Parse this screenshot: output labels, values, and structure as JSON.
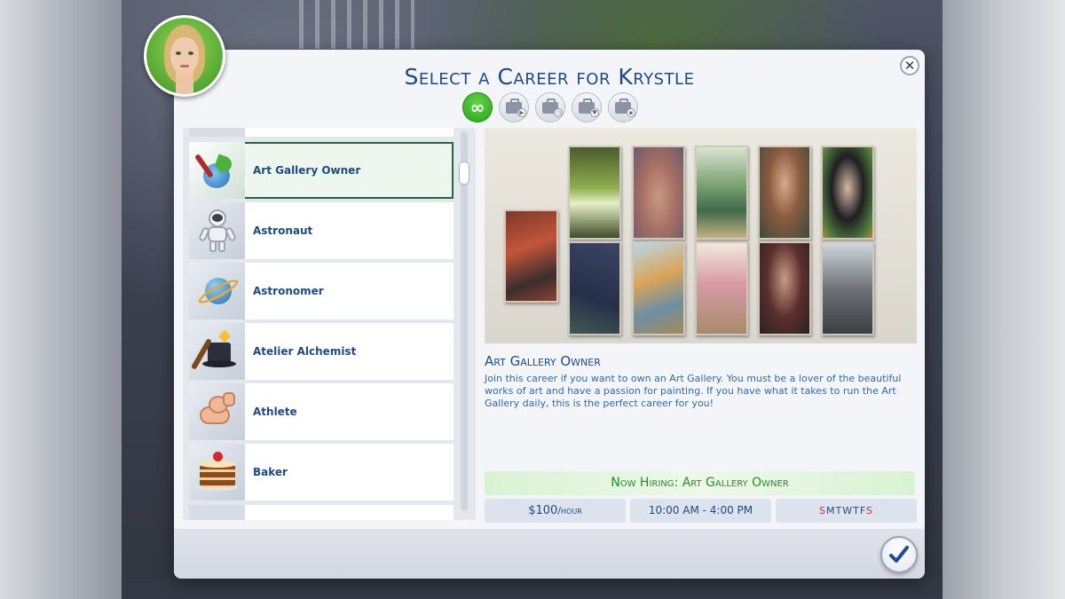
{
  "dialog": {
    "title": "Select a Career for Krystle",
    "close_label": "✕"
  },
  "filters": [
    {
      "name": "all",
      "icon": "infinity-icon",
      "active": true
    },
    {
      "name": "active-careers",
      "icon": "briefcase-play-icon",
      "active": false
    },
    {
      "name": "part-time",
      "icon": "briefcase-clock-icon",
      "active": false
    },
    {
      "name": "volunteer",
      "icon": "briefcase-heart-icon",
      "active": false
    },
    {
      "name": "freelance",
      "icon": "briefcases-icon",
      "active": false
    }
  ],
  "careers": [
    {
      "label": "Art Gallery Owner",
      "icon": "paintbrush-globe-icon",
      "selected": true
    },
    {
      "label": "Astronaut",
      "icon": "astronaut-icon",
      "selected": false
    },
    {
      "label": "Astronomer",
      "icon": "planet-icon",
      "selected": false
    },
    {
      "label": "Atelier Alchemist",
      "icon": "magic-hat-icon",
      "selected": false
    },
    {
      "label": "Athlete",
      "icon": "flexed-arm-icon",
      "selected": false
    },
    {
      "label": "Baker",
      "icon": "cake-icon",
      "selected": false
    }
  ],
  "detail": {
    "title": "Art Gallery Owner",
    "description": "Join this career if you want to own an Art Gallery. You must be a lover of the beautiful works of art and have a passion for painting. If you have what it takes to run the Art Gallery daily, this is the perfect career for you!",
    "hiring": "Now Hiring: Art Gallery Owner",
    "salary_amount": "$100",
    "salary_unit": "/hour",
    "hours": "10:00  AM - 4:00  PM",
    "days": [
      {
        "letter": "S",
        "weekend": true
      },
      {
        "letter": "M",
        "weekend": false
      },
      {
        "letter": "T",
        "weekend": false
      },
      {
        "letter": "W",
        "weekend": false
      },
      {
        "letter": "T",
        "weekend": false
      },
      {
        "letter": "F",
        "weekend": false
      },
      {
        "letter": "S",
        "weekend": true
      }
    ]
  },
  "colors": {
    "title_blue": "#1d4a86",
    "text_blue": "#2e6aad",
    "hiring_green": "#2a8a2a",
    "active_filter_green": "#27a51b",
    "weekend_red": "#c8323a"
  }
}
